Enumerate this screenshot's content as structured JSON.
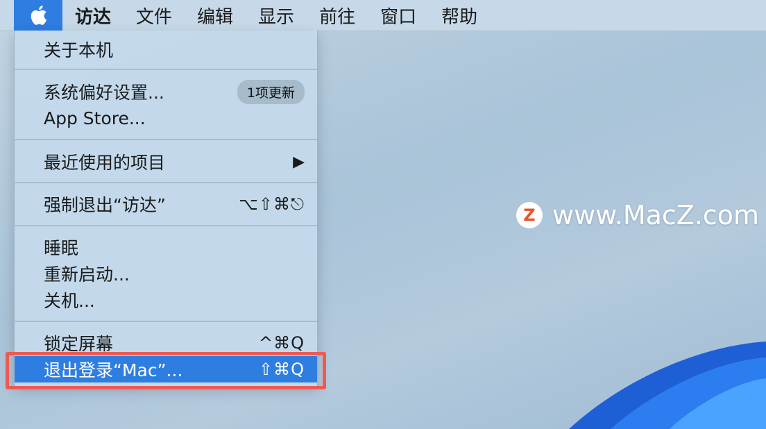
{
  "menubar": {
    "items": [
      "访达",
      "文件",
      "编辑",
      "显示",
      "前往",
      "窗口",
      "帮助"
    ]
  },
  "apple_menu": {
    "about": "关于本机",
    "system_prefs": "系统偏好设置...",
    "update_badge": "1项更新",
    "app_store": "App Store...",
    "recent_items": "最近使用的项目",
    "force_quit": "强制退出“访达”",
    "force_quit_shortcut": "⌥⇧⌘⎋",
    "sleep": "睡眠",
    "restart": "重新启动...",
    "shutdown": "关机...",
    "lock_screen": "锁定屏幕",
    "lock_screen_shortcut": "^⌘Q",
    "logout": "退出登录“Mac”...",
    "logout_shortcut": "⇧⌘Q"
  },
  "watermark": {
    "text": "www.MacZ.com",
    "logo_letter": "Z"
  },
  "colors": {
    "accent": "#2e7ee2",
    "highlight_box": "#ee5a52",
    "watermark_logo": "#e8542d"
  }
}
